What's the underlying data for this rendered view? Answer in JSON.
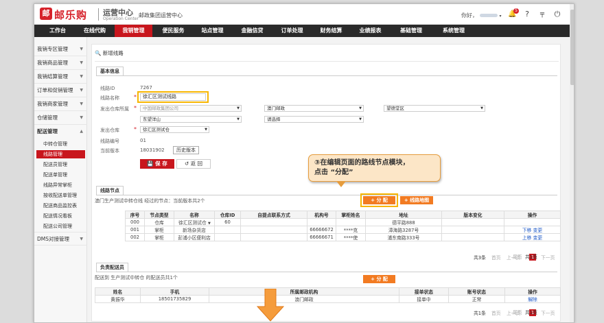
{
  "header": {
    "logo_mark": "邮",
    "logo_text": "邮乐购",
    "center_title": "运营中心",
    "center_title_en": "Operation Center",
    "org_name": "邮政集团运营中心",
    "greeting": "你好，",
    "notification_count": "5"
  },
  "nav": [
    "工作台",
    "在线代购",
    "我销管理",
    "便民服务",
    "站点管理",
    "金融信贷",
    "订单处理",
    "财务结算",
    "业绩报表",
    "基础管理",
    "系统管理"
  ],
  "nav_active": "我销管理",
  "sidebar": {
    "items": [
      "我销专区管理",
      "我销商品管理",
      "我销结算管理",
      "订单和促销管理",
      "我销商家管理",
      "仓储管理",
      "配送管理",
      "DMS对接管理"
    ],
    "sub_items": [
      "中转仓管理",
      "线路管理",
      "配送员管理",
      "配送单管理",
      "线路异常掌柜",
      "按收配送单管理",
      "配送商品监控表",
      "配送情况看板",
      "配送公司管理"
    ],
    "active_sub": "线路管理"
  },
  "page": {
    "title": "新增线路",
    "basic_tab": "基本信息",
    "fields": {
      "route_id_label": "线路ID",
      "route_id": "7267",
      "route_name_label": "线路名称",
      "route_name": "徐汇区测试线路",
      "warehouse_owner_label": "发出仓库所属",
      "company": "中国邮政集团公司",
      "region1": "澳门邮政",
      "region2": "望德堂区",
      "region3": "东望洋山",
      "region4": "请选择",
      "warehouse_label": "发出仓库",
      "warehouse": "徐汇区测试仓",
      "route_no_label": "线路编号",
      "route_no": "01",
      "version_label": "当前版本",
      "version": "18031902",
      "history_button": "历史版本"
    },
    "save_button": "保  存",
    "back_button": "返  回",
    "nodes_tab": "线路节点",
    "nodes_summary": "澳门生产测试中转仓线 经过的节点：当前版本共2个",
    "assign_button": "分  配",
    "map_button": "线路地图",
    "nodes_table": {
      "headers": [
        "序号",
        "节点类型",
        "名称",
        "仓库ID",
        "自提点联系方式",
        "机构号",
        "掌柜姓名",
        "地址",
        "版本变化",
        "操作"
      ],
      "rows": [
        {
          "no": "000",
          "type": "仓库",
          "name": "徐汇区测试仓",
          "wid": "60",
          "contact": "",
          "org": "",
          "keeper": "",
          "addr": "德平路888",
          "change": "",
          "ops": []
        },
        {
          "no": "001",
          "type": "掌柜",
          "name": "新场杂货店",
          "wid": "",
          "contact": "",
          "org": "66666672",
          "keeper": "****克",
          "addr": "漳海路3287号",
          "change": "",
          "ops": [
            "下移",
            "变更"
          ]
        },
        {
          "no": "002",
          "type": "掌柜",
          "name": "彭浦小区便利店",
          "wid": "",
          "contact": "",
          "org": "66666671",
          "keeper": "****使",
          "addr": "浦东南路333号",
          "change": "",
          "ops": [
            "上移",
            "变更"
          ]
        }
      ]
    },
    "pager": {
      "total": "共3条",
      "first": "首页",
      "prev": "上一页",
      "current": "1",
      "next": "下一页",
      "last": "尾页",
      "pages": "共1页"
    },
    "staff_tab": "负责配送员",
    "staff_summary": "配送到 生产测试中转仓 的配送员共1个",
    "staff_assign_button": "分  配",
    "staff_table": {
      "headers": [
        "姓名",
        "手机",
        "所属邮政机构",
        "接单状态",
        "账号状态",
        "操作"
      ],
      "rows": [
        {
          "name": "黄振华",
          "phone": "18501735829",
          "org": "澳门邮政",
          "order_status": "接单中",
          "acct_status": "正常",
          "op": "解除"
        }
      ]
    },
    "pager2": {
      "total": "共1条",
      "first": "首页",
      "prev": "上一页",
      "current": "1",
      "next": "下一页",
      "last": "尾页",
      "pages": "共1页"
    }
  },
  "callout": {
    "line1": "③在编辑页面的路线节点模块，",
    "line2": "点击 “分配”"
  },
  "colors": {
    "brand": "#c8161d",
    "accent_orange": "#f27b22",
    "highlight": "#f7b500",
    "callout_bg": "#fce6c7"
  }
}
